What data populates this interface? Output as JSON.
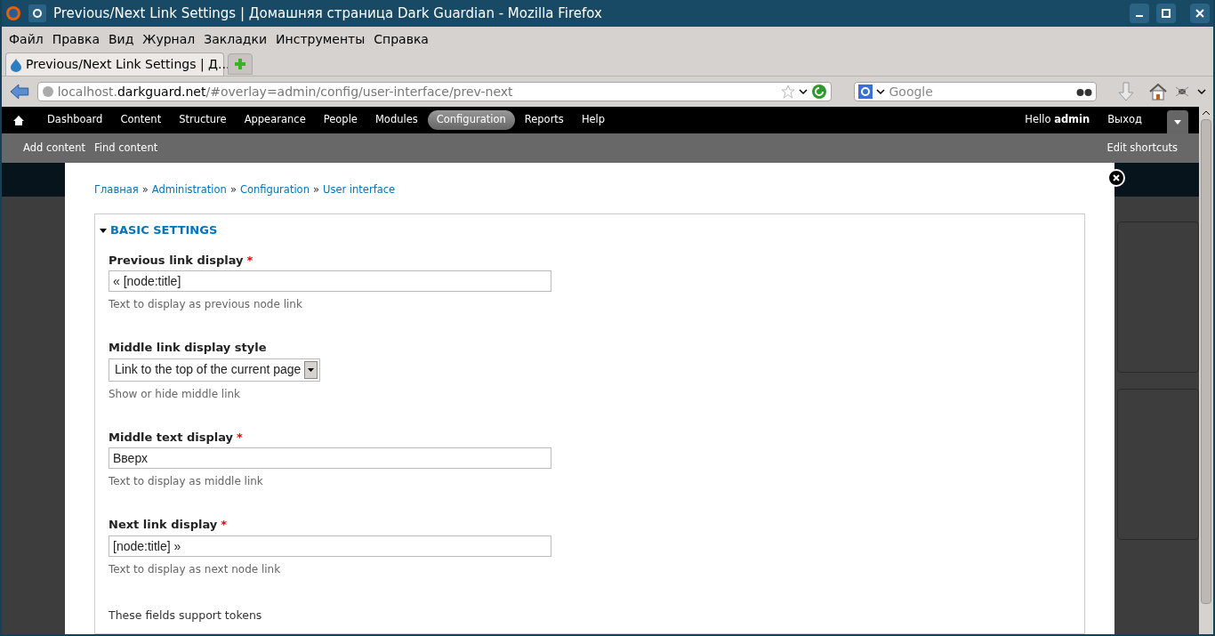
{
  "window": {
    "title": "Previous/Next Link Settings | Домашняя страница Dark Guardian - Mozilla Firefox"
  },
  "menu": [
    "Файл",
    "Правка",
    "Вид",
    "Журнал",
    "Закладки",
    "Инструменты",
    "Справка"
  ],
  "tabs": [
    {
      "label": "Previous/Next Link Settings | Д...",
      "selected": true
    }
  ],
  "address": {
    "host_prefix": "localhost.",
    "domain": "darkguard.net",
    "path": "/#overlay=admin/config/user-interface/prev-next"
  },
  "search": {
    "placeholder": "Google"
  },
  "admin_menu": [
    {
      "label": "Dashboard",
      "selected": false
    },
    {
      "label": "Content",
      "selected": false
    },
    {
      "label": "Structure",
      "selected": false
    },
    {
      "label": "Appearance",
      "selected": false
    },
    {
      "label": "People",
      "selected": false
    },
    {
      "label": "Modules",
      "selected": false
    },
    {
      "label": "Configuration",
      "selected": true
    },
    {
      "label": "Reports",
      "selected": false
    },
    {
      "label": "Help",
      "selected": false
    }
  ],
  "user": {
    "greeting": "Hello",
    "name": "admin",
    "logout": "Выход"
  },
  "shortcuts": [
    "Add content",
    "Find content"
  ],
  "edit_shortcuts": "Edit shortcuts",
  "breadcrumb": [
    "Главная",
    "Administration",
    "Configuration",
    "User interface"
  ],
  "breadcrumb_separator": "»",
  "required_mark": "*",
  "fieldset": {
    "title": "BASIC SETTINGS",
    "expanded": true
  },
  "fields": [
    {
      "kind": "text",
      "label": "Previous link display",
      "required": true,
      "value": "« [node:title]",
      "description": "Text to display as previous node link"
    },
    {
      "kind": "select",
      "label": "Middle link display style",
      "required": false,
      "value": "Link to the top of the current page",
      "description": "Show or hide middle link"
    },
    {
      "kind": "text",
      "label": "Middle text display",
      "required": true,
      "value": "Вверх",
      "description": "Text to display as middle link"
    },
    {
      "kind": "text",
      "label": "Next link display",
      "required": true,
      "value": "[node:title] »",
      "description": "Text to display as next node link"
    }
  ],
  "note": "These fields support tokens"
}
